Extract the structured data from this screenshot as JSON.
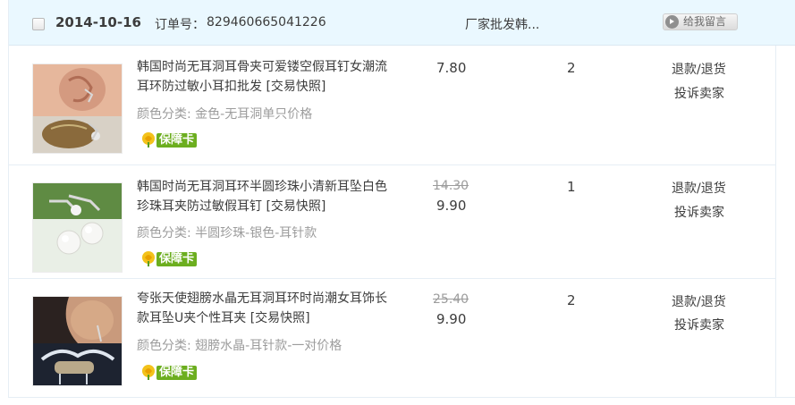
{
  "order": {
    "date": "2014-10-16",
    "order_no_label": "订单号：",
    "order_no": "829460665041226",
    "shop_name": "厂家批发韩...",
    "message_button": "给我留言"
  },
  "items": [
    {
      "title": "韩国时尚无耳洞耳骨夹可爱镂空假耳钉女潮流耳环防过敏小耳扣批发 [交易快照]",
      "attr": "颜色分类: 金色-无耳洞单只价格",
      "badge": "保障卡",
      "original_price": "",
      "price": "7.80",
      "quantity": "2",
      "action_refund": "退款/退货",
      "action_complain": "投诉卖家"
    },
    {
      "title": "韩国时尚无耳洞耳环半圆珍珠小清新耳坠白色珍珠耳夹防过敏假耳钉 [交易快照]",
      "attr": "颜色分类: 半圆珍珠-银色-耳针款",
      "badge": "保障卡",
      "original_price": "14.30",
      "price": "9.90",
      "quantity": "1",
      "action_refund": "退款/退货",
      "action_complain": "投诉卖家"
    },
    {
      "title": "夸张天使翅膀水晶无耳洞耳环时尚潮女耳饰长款耳坠U夹个性耳夹 [交易快照]",
      "attr": "颜色分类: 翅膀水晶-耳针款-一对价格",
      "badge": "保障卡",
      "original_price": "25.40",
      "price": "9.90",
      "quantity": "2",
      "action_refund": "退款/退货",
      "action_complain": "投诉卖家"
    }
  ]
}
